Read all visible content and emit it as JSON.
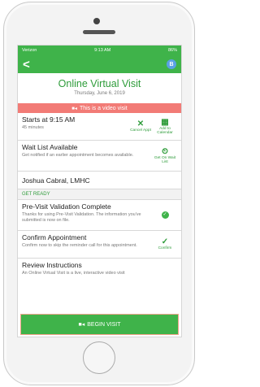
{
  "status": {
    "carrier": "Verizon",
    "time": "9:13 AM",
    "battery": "86%"
  },
  "nav": {
    "back": "<",
    "avatar": "B"
  },
  "header": {
    "title": "Online Virtual Visit",
    "date": "Thursday, June 6, 2019"
  },
  "banner": {
    "text": "This is a video visit"
  },
  "start": {
    "title": "Starts at 9:15 AM",
    "duration": "45 minutes",
    "cancel": "Cancel Appt",
    "calendar": "Add to Calendar"
  },
  "waitlist": {
    "title": "Wait List Available",
    "desc": "Get notified if an earlier appointment becomes available.",
    "action": "Get On Wait List"
  },
  "provider": {
    "name": "Joshua Cabral, LMHC"
  },
  "section": {
    "label": "GET READY"
  },
  "prevalidation": {
    "title": "Pre-Visit Validation Complete",
    "desc": "Thanks for using Pre-Visit Validation. The information you've submitted is now on file."
  },
  "confirm": {
    "title": "Confirm Appointment",
    "desc": "Confirm now to skip the reminder call for this appointment.",
    "action": "Confirm"
  },
  "review": {
    "title": "Review Instructions",
    "desc": "An Online Virtual Visit is a live, interactive video visit"
  },
  "begin": {
    "label": "BEGIN VISIT"
  },
  "colors": {
    "accent": "#3fb34a",
    "banner": "#f27b76"
  }
}
